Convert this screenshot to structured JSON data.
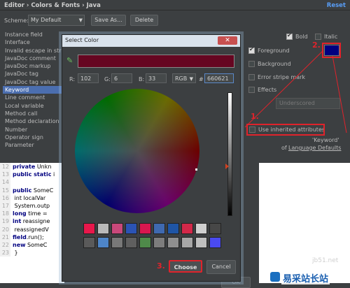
{
  "breadcrumb": "Editor › Colors & Fonts › Java",
  "reset_label": "Reset",
  "scheme": {
    "label": "Scheme:",
    "value": "My Default",
    "save_as": "Save As...",
    "delete": "Delete"
  },
  "tree_items": [
    "Instance field",
    "Interface",
    "Invalid escape in strin",
    "JavaDoc comment",
    "JavaDoc markup",
    "JavaDoc tag",
    "JavaDoc tag value",
    "Keyword",
    "Line comment",
    "Local variable",
    "Method call",
    "Method declaration",
    "Number",
    "Operator sign",
    "Parameter"
  ],
  "selected_tree_index": 7,
  "font_style": {
    "bold": "Bold",
    "italic": "Italic"
  },
  "options": {
    "foreground": "Foreground",
    "background": "Background",
    "error_stripe": "Error stripe mark",
    "effects": "Effects",
    "effects_style": "Underscored",
    "inherit": "Use inherited attributes",
    "inherit_from": "'Keyword'",
    "inherit_of": "of",
    "language_defaults": "Language Defaults"
  },
  "colors": {
    "foreground_swatch": "#000080",
    "current": "#660621",
    "accent_red": "#e0232b"
  },
  "code_lines": [
    {
      "n": "12",
      "kw": "private",
      "tx": " Unkn"
    },
    {
      "n": "13",
      "kw": "public static",
      "tx": " i"
    },
    {
      "n": "14",
      "kw": "",
      "tx": ""
    },
    {
      "n": "15",
      "kw": "public",
      "tx": " SomeC"
    },
    {
      "n": "16",
      "kw": "",
      "tx": "  int localVar"
    },
    {
      "n": "17",
      "kw": "",
      "tx": "  System.outp"
    },
    {
      "n": "18",
      "kw": "long",
      "tx": " time ="
    },
    {
      "n": "19",
      "kw": "int",
      "tx": " reassigne"
    },
    {
      "n": "20",
      "kw": "",
      "tx": "  reassignedV"
    },
    {
      "n": "21",
      "kw": "field",
      "tx": ".run();"
    },
    {
      "n": "22",
      "kw": "new",
      "tx": " SomeC"
    },
    {
      "n": "23",
      "kw": "",
      "tx": "  }"
    }
  ],
  "ok_label": "OK",
  "dialog": {
    "title": "Select Color",
    "close": "✕",
    "r_label": "R:",
    "r": "102",
    "g_label": "G:",
    "g": "6",
    "b_label": "B:",
    "b": "33",
    "mode": "RGB",
    "hash": "#",
    "hex": "660621",
    "choose": "Choose",
    "cancel": "Cancel",
    "recent_colors": [
      "#e8174b",
      "#b9b9b9",
      "#c8487a",
      "#2b53b4",
      "#d8174f",
      "#3f69b0",
      "#1f55a5",
      "#d32849",
      "#cfcfcf",
      "#474747",
      "#5a5a5a",
      "#4e85c8",
      "#787878",
      "#5f5f5f",
      "#4f8a4a",
      "#7d7d7d",
      "#8f8f8f",
      "#a7a7a7",
      "#c0c0c0",
      "#4a4af0"
    ]
  },
  "annotations": {
    "step1": "1.",
    "step2": "2.",
    "step3": "3."
  },
  "watermark": {
    "site": "jb51.net",
    "brand": "易采站长站"
  }
}
